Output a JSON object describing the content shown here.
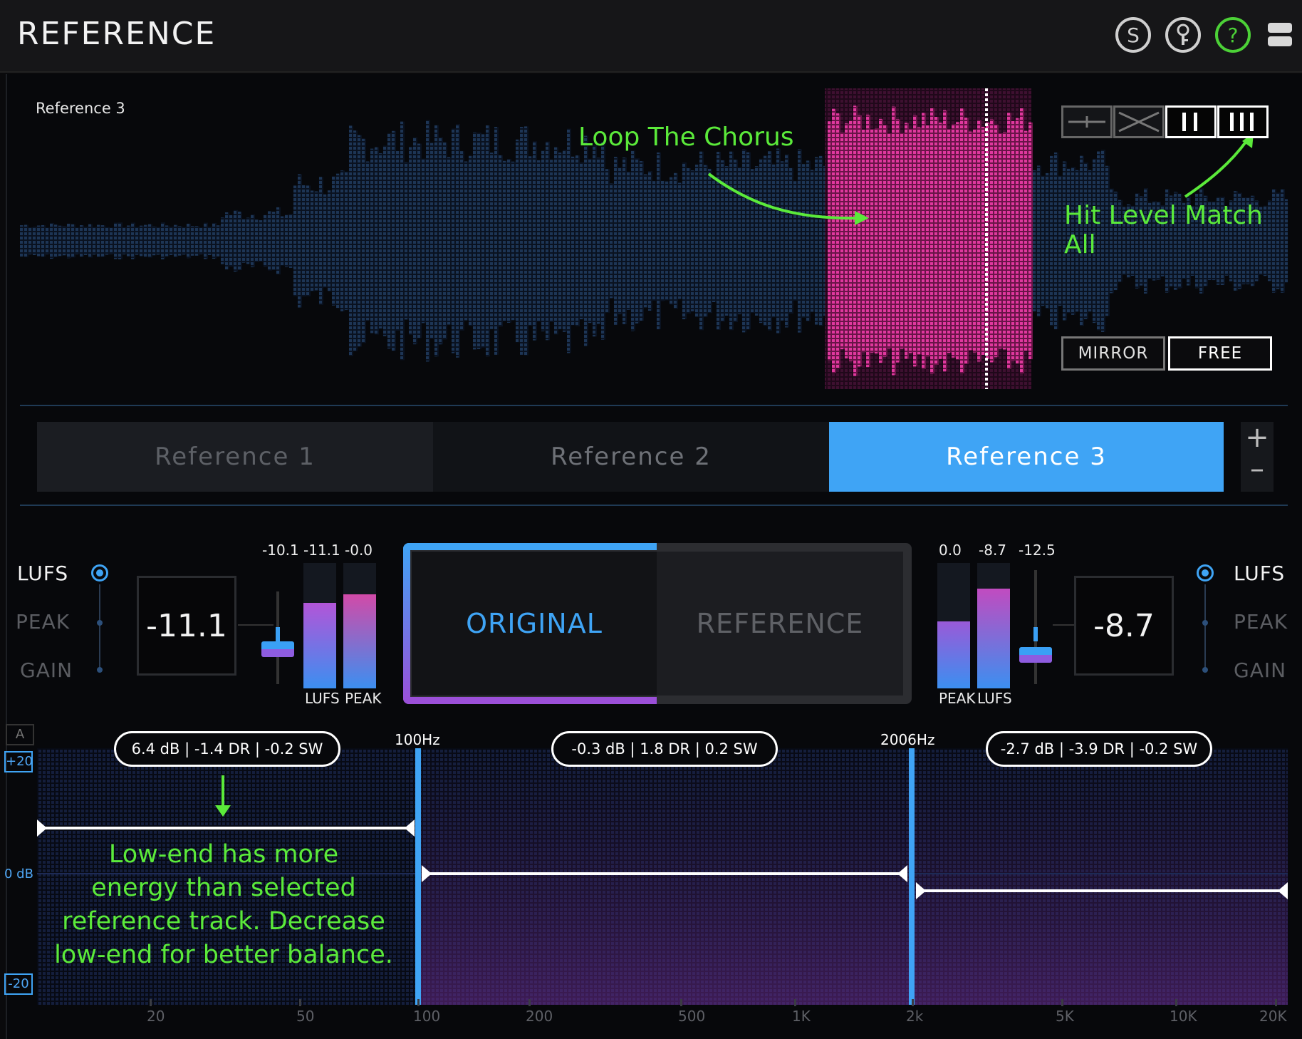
{
  "header": {
    "title": "REFERENCE",
    "icons": [
      "s-icon",
      "key-icon",
      "help-icon",
      "menu-icon"
    ],
    "s_label": "S",
    "help_label": "?"
  },
  "waveform": {
    "track_label": "Reference 3",
    "annotation_loop": "Loop The Chorus",
    "annotation_level": "Hit Level Match All",
    "mode_buttons": [
      "single-line",
      "crossfade",
      "level-match-2",
      "level-match-all"
    ],
    "mirror_label": "MIRROR",
    "free_label": "FREE",
    "free_active": true
  },
  "tabs": {
    "items": [
      "Reference 1",
      "Reference 2",
      "Reference 3"
    ],
    "active": 2,
    "add_label": "+",
    "remove_label": "–"
  },
  "left_meter": {
    "lufs_label": "LUFS",
    "peak_label": "PEAK",
    "gain_label": "GAIN",
    "value": "-11.1",
    "top_values": [
      "-10.1",
      "-11.1",
      "-0.0"
    ],
    "bar_labels": [
      "LUFS",
      "PEAK"
    ]
  },
  "compare": {
    "original_label": "ORIGINAL",
    "reference_label": "REFERENCE",
    "active": "original"
  },
  "right_meter": {
    "lufs_label": "LUFS",
    "peak_label": "PEAK",
    "gain_label": "GAIN",
    "value": "-8.7",
    "top_values": [
      "0.0",
      "-8.7",
      "-12.5"
    ],
    "bar_labels": [
      "PEAK",
      "LUFS"
    ]
  },
  "eq": {
    "a_label": "A",
    "scale_top": "+20",
    "scale_mid": "0 dB",
    "scale_bottom": "-20",
    "bands": [
      {
        "info": "6.4 dB | -1.4 DR | -0.2 SW"
      },
      {
        "info": "-0.3 dB | 1.8 DR | 0.2 SW"
      },
      {
        "info": "-2.7 dB | -3.9 DR | -0.2 SW"
      }
    ],
    "crossovers": [
      "100Hz",
      "2006Hz"
    ],
    "annotation": [
      "Low-end has more",
      "energy than selected",
      "reference track. Decrease",
      "low-end for better balance."
    ],
    "axis": [
      "20",
      "50",
      "100",
      "200",
      "500",
      "1K",
      "2k",
      "5K",
      "10K",
      "20K"
    ],
    "colors": {
      "accent": "#3fa4f5",
      "annotation": "#5bea3a",
      "waveform_selected": "#e0389e"
    }
  }
}
